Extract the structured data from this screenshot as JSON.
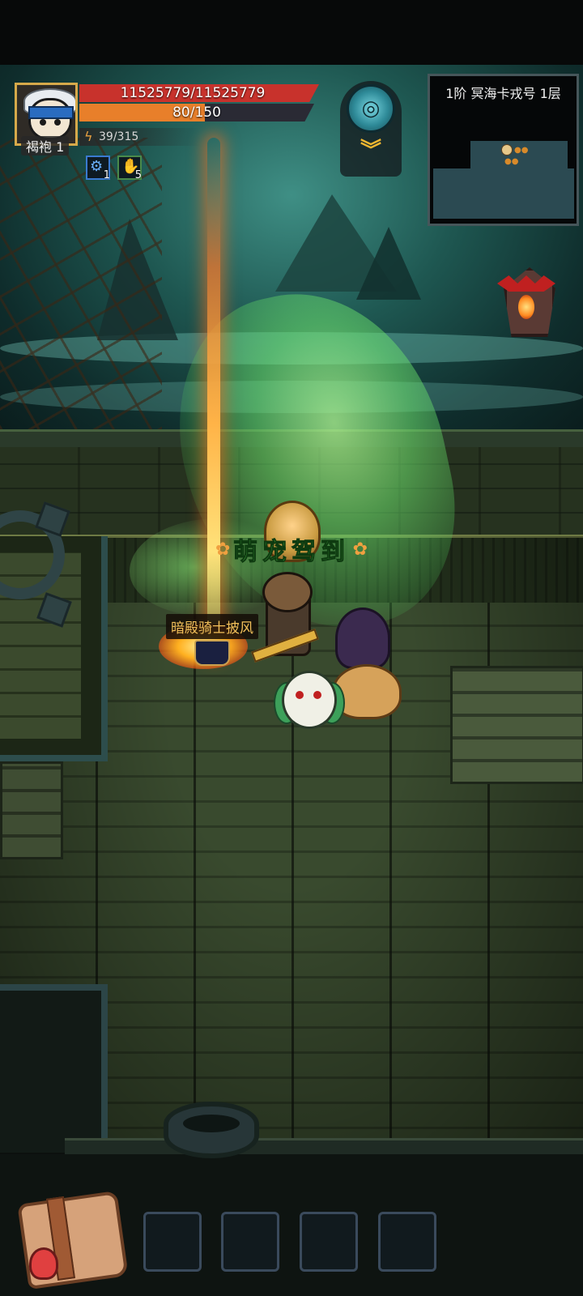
{
  "player": {
    "level_label": "褐袍 1",
    "hp_text": "11525779/11525779",
    "hp_fraction": 1.0,
    "mp_text": "80/150",
    "mp_fraction": 0.533,
    "energy_text": "39/315"
  },
  "buffs": [
    {
      "icon": "gear-buff-icon",
      "count": "1"
    },
    {
      "icon": "claw-buff-icon",
      "count": "5"
    }
  ],
  "minimap": {
    "title": "1阶 冥海卡戎号 1层"
  },
  "loot": {
    "label": "暗殿骑士披风"
  },
  "banner": {
    "text": "萌宠驾到"
  },
  "colors": {
    "hp": "#c8322c",
    "mp": "#e87f2a",
    "accent_gold": "#d6a94a",
    "loot_label": "#f2c05a"
  },
  "hotbar_slots": 4
}
